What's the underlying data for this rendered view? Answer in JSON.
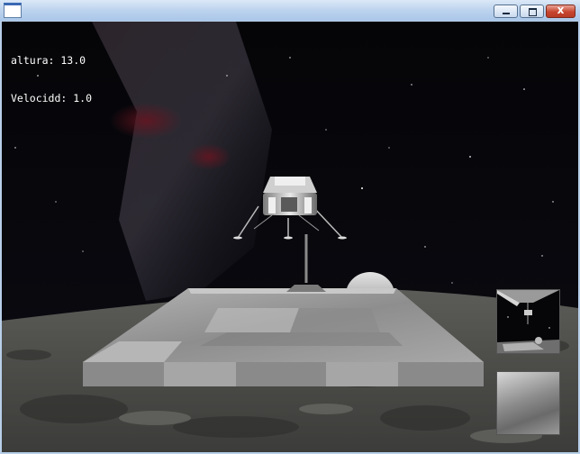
{
  "window": {
    "title": "",
    "buttons": [
      "minimize",
      "maximize",
      "close"
    ]
  },
  "hud": {
    "altitude_label": "altura: 13.0",
    "velocity_label": "Velocidd: 1.0"
  },
  "icons": {
    "app": "window-icon",
    "minimize": "minimize-icon",
    "maximize": "maximize-icon",
    "close": "close-icon"
  },
  "close_glyph": "x",
  "colors": {
    "sky": "#07070c",
    "ground": "#5a5a5a",
    "platform": "#a0a0a0",
    "hud_text": "#ffffff"
  }
}
